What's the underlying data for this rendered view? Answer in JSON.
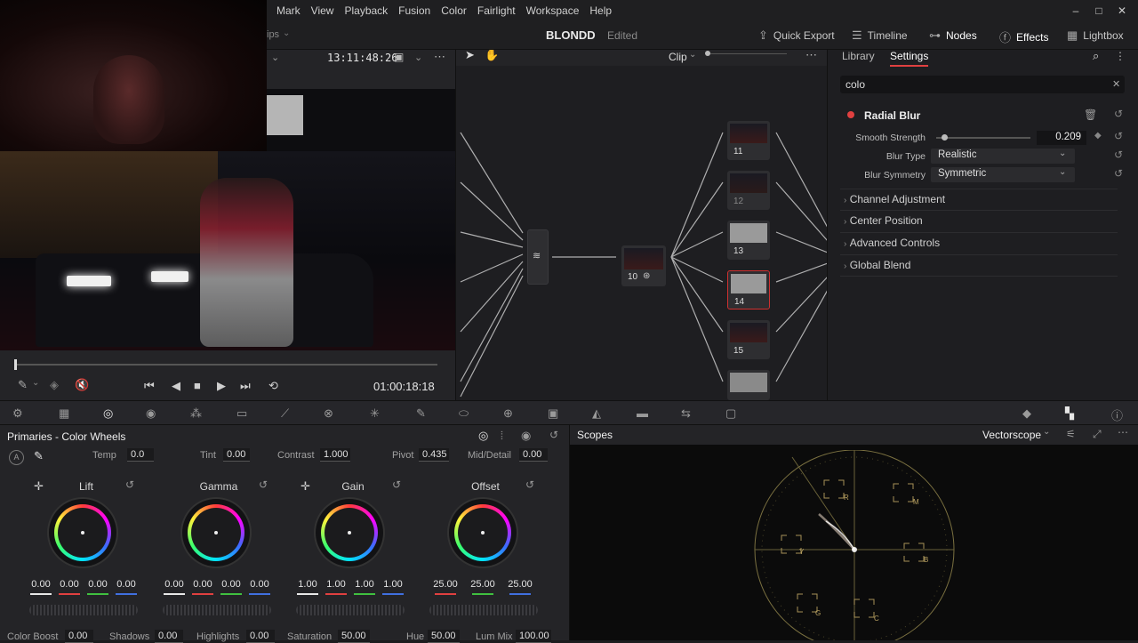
{
  "menu": [
    "Mark",
    "View",
    "Playback",
    "Fusion",
    "Color",
    "Fairlight",
    "Workspace",
    "Help"
  ],
  "window_controls": {
    "min": "–",
    "max": "□",
    "close": "✕"
  },
  "topbar": {
    "left_tab_partial": "ips",
    "project": "BLONDD",
    "status": "Edited",
    "quick_export": "Quick Export",
    "timeline": "Timeline",
    "nodes": "Nodes",
    "effects": "Effects",
    "lightbox": "Lightbox"
  },
  "viewer": {
    "timecode_source": "13:11:48:26",
    "timecode_record": "01:00:18:18",
    "playhead_fraction": 0.0
  },
  "nodegraph": {
    "mode_label": "Clip",
    "nodes": [
      {
        "id": "10",
        "label": "10"
      },
      {
        "id": "11",
        "label": "11"
      },
      {
        "id": "12",
        "label": "12"
      },
      {
        "id": "13",
        "label": "13"
      },
      {
        "id": "14",
        "label": "14"
      },
      {
        "id": "15",
        "label": "15"
      }
    ]
  },
  "inspector": {
    "tabs": [
      "Library",
      "Settings"
    ],
    "active_tab": "Settings",
    "search_value": "colo",
    "effect_name": "Radial Blur",
    "params": [
      {
        "label": "Smooth Strength",
        "value": "0.209",
        "slider_fraction": 0.06
      },
      {
        "label": "Blur Type",
        "value": "Realistic"
      },
      {
        "label": "Blur Symmetry",
        "value": "Symmetric"
      }
    ],
    "sections": [
      "Channel Adjustment",
      "Center Position",
      "Advanced Controls",
      "Global Blend"
    ]
  },
  "primaries": {
    "title": "Primaries - Color Wheels",
    "top_fields": [
      {
        "label": "Temp",
        "value": "0.0"
      },
      {
        "label": "Tint",
        "value": "0.00"
      },
      {
        "label": "Contrast",
        "value": "1.000"
      },
      {
        "label": "Pivot",
        "value": "0.435"
      },
      {
        "label": "Mid/Detail",
        "value": "0.00"
      }
    ],
    "wheels": [
      {
        "name": "Lift",
        "values": [
          "0.00",
          "0.00",
          "0.00",
          "0.00"
        ]
      },
      {
        "name": "Gamma",
        "values": [
          "0.00",
          "0.00",
          "0.00",
          "0.00"
        ]
      },
      {
        "name": "Gain",
        "values": [
          "1.00",
          "1.00",
          "1.00",
          "1.00"
        ]
      },
      {
        "name": "Offset",
        "values": [
          "25.00",
          "25.00",
          "25.00"
        ]
      }
    ],
    "bottom_fields": [
      {
        "label": "Color Boost",
        "value": "0.00"
      },
      {
        "label": "Shadows",
        "value": "0.00"
      },
      {
        "label": "Highlights",
        "value": "0.00"
      },
      {
        "label": "Saturation",
        "value": "50.00"
      },
      {
        "label": "Hue",
        "value": "50.00"
      },
      {
        "label": "Lum Mix",
        "value": "100.00"
      }
    ],
    "channel_colors": [
      "#e8e8e8",
      "#e04040",
      "#40c040",
      "#4070e0"
    ]
  },
  "scopes": {
    "title": "Scopes",
    "mode": "Vectorscope",
    "targets": [
      "R",
      "M",
      "B",
      "C",
      "G",
      "Y"
    ]
  },
  "colors": {
    "accent_red": "#e04040",
    "node_green": "#9ee03a",
    "node_blue": "#3aa8e0",
    "selected_node": "#d03030"
  }
}
